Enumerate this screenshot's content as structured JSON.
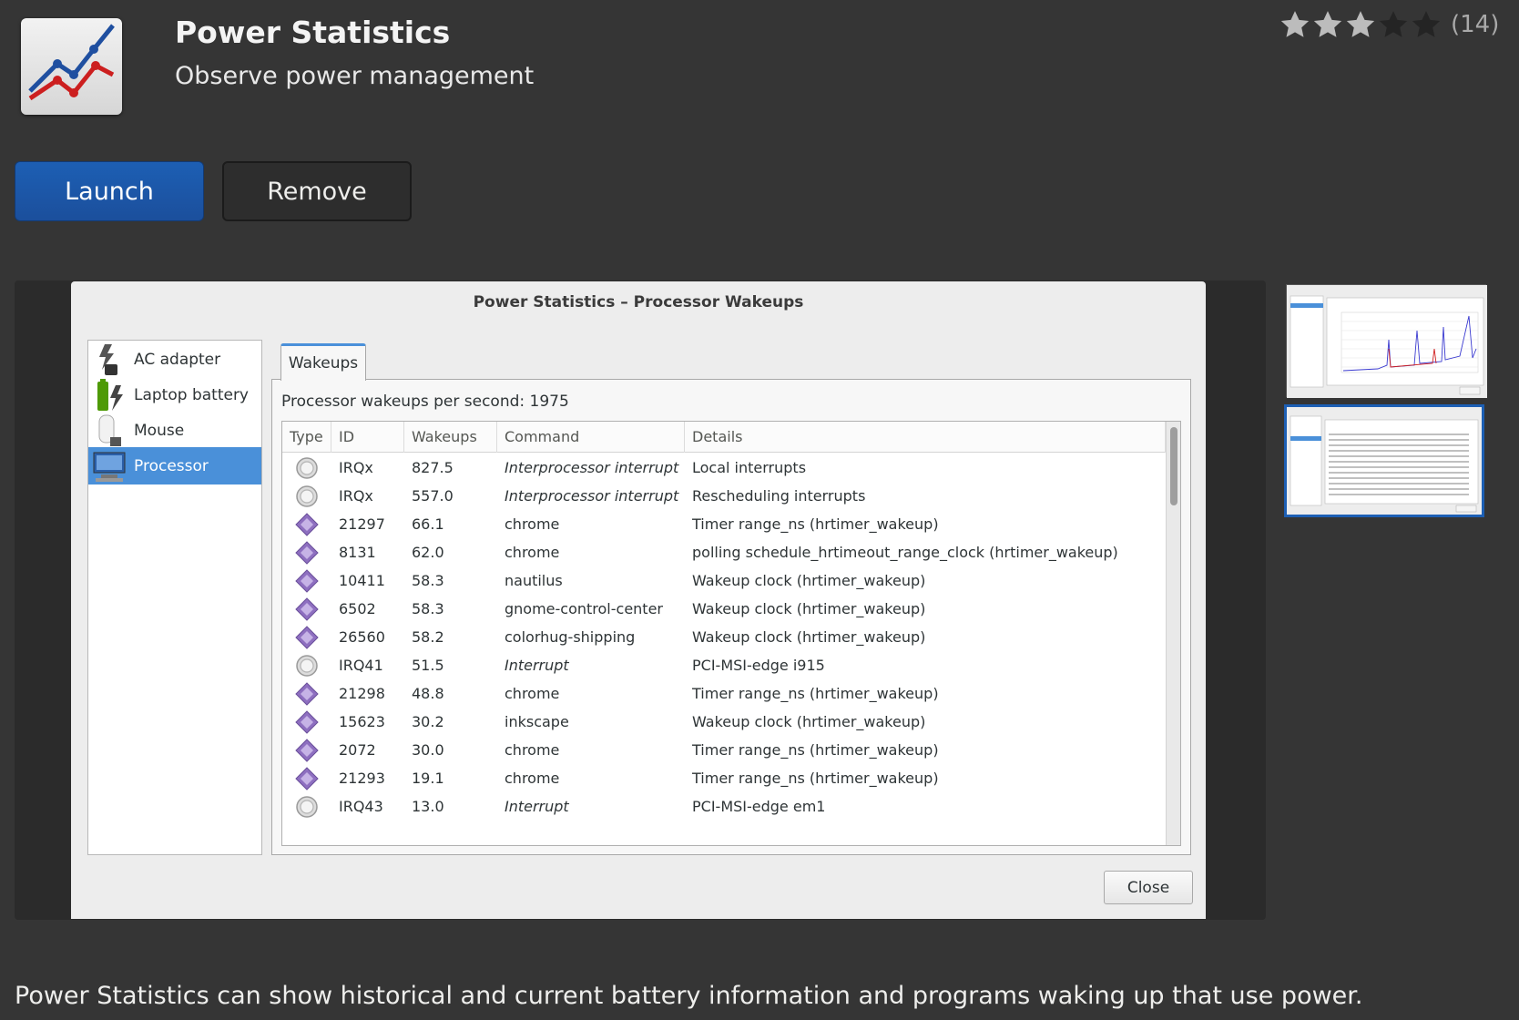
{
  "app": {
    "name": "Power Statistics",
    "summary": "Observe power management",
    "rating": {
      "value": 3,
      "max": 5,
      "count_label": "(14)"
    },
    "description": "Power Statistics can show historical and current battery information and programs waking up that use power."
  },
  "actions": {
    "launch_label": "Launch",
    "remove_label": "Remove"
  },
  "screenshot": {
    "window_title": "Power Statistics – Processor Wakeups",
    "devices": [
      {
        "label": "AC adapter",
        "icon": "ac-adapter-icon",
        "selected": false
      },
      {
        "label": "Laptop battery",
        "icon": "battery-icon",
        "selected": false
      },
      {
        "label": "Mouse",
        "icon": "mouse-icon",
        "selected": false
      },
      {
        "label": "Processor",
        "icon": "processor-icon",
        "selected": true
      }
    ],
    "tab_label": "Wakeups",
    "wakeups_label": "Processor wakeups per second: 1975",
    "columns": [
      "Type",
      "ID",
      "Wakeups",
      "Command",
      "Details"
    ],
    "rows": [
      {
        "type": "interrupt",
        "id": "IRQx",
        "wakeups": "827.5",
        "command": "Interprocessor interrupt",
        "command_italic": true,
        "details": "Local interrupts"
      },
      {
        "type": "interrupt",
        "id": "IRQx",
        "wakeups": "557.0",
        "command": "Interprocessor interrupt",
        "command_italic": true,
        "details": "Rescheduling interrupts"
      },
      {
        "type": "process",
        "id": "21297",
        "wakeups": "66.1",
        "command": "chrome",
        "command_italic": false,
        "details": "Timer range_ns (hrtimer_wakeup)"
      },
      {
        "type": "process",
        "id": "8131",
        "wakeups": "62.0",
        "command": "chrome",
        "command_italic": false,
        "details": "polling  schedule_hrtimeout_range_clock (hrtimer_wakeup)"
      },
      {
        "type": "process",
        "id": "10411",
        "wakeups": "58.3",
        "command": "nautilus",
        "command_italic": false,
        "details": "Wakeup clock (hrtimer_wakeup)"
      },
      {
        "type": "process",
        "id": "6502",
        "wakeups": "58.3",
        "command": "gnome-control-center",
        "command_italic": false,
        "details": "Wakeup clock (hrtimer_wakeup)"
      },
      {
        "type": "process",
        "id": "26560",
        "wakeups": "58.2",
        "command": "colorhug-shipping",
        "command_italic": false,
        "details": "Wakeup clock (hrtimer_wakeup)"
      },
      {
        "type": "interrupt",
        "id": "IRQ41",
        "wakeups": "51.5",
        "command": "Interrupt",
        "command_italic": true,
        "details": "PCI-MSI-edge      i915"
      },
      {
        "type": "process",
        "id": "21298",
        "wakeups": "48.8",
        "command": "chrome",
        "command_italic": false,
        "details": "Timer range_ns (hrtimer_wakeup)"
      },
      {
        "type": "process",
        "id": "15623",
        "wakeups": "30.2",
        "command": "inkscape",
        "command_italic": false,
        "details": "Wakeup clock (hrtimer_wakeup)"
      },
      {
        "type": "process",
        "id": "2072",
        "wakeups": "30.0",
        "command": "chrome",
        "command_italic": false,
        "details": "Timer range_ns (hrtimer_wakeup)"
      },
      {
        "type": "process",
        "id": "21293",
        "wakeups": "19.1",
        "command": "chrome",
        "command_italic": false,
        "details": "Timer range_ns (hrtimer_wakeup)"
      },
      {
        "type": "interrupt",
        "id": "IRQ43",
        "wakeups": "13.0",
        "command": "Interrupt",
        "command_italic": true,
        "details": "PCI-MSI-edge      em1"
      }
    ],
    "close_label": "Close"
  },
  "colors": {
    "accent": "#1d5fb4",
    "selection": "#4a90d9",
    "background": "#353535"
  }
}
